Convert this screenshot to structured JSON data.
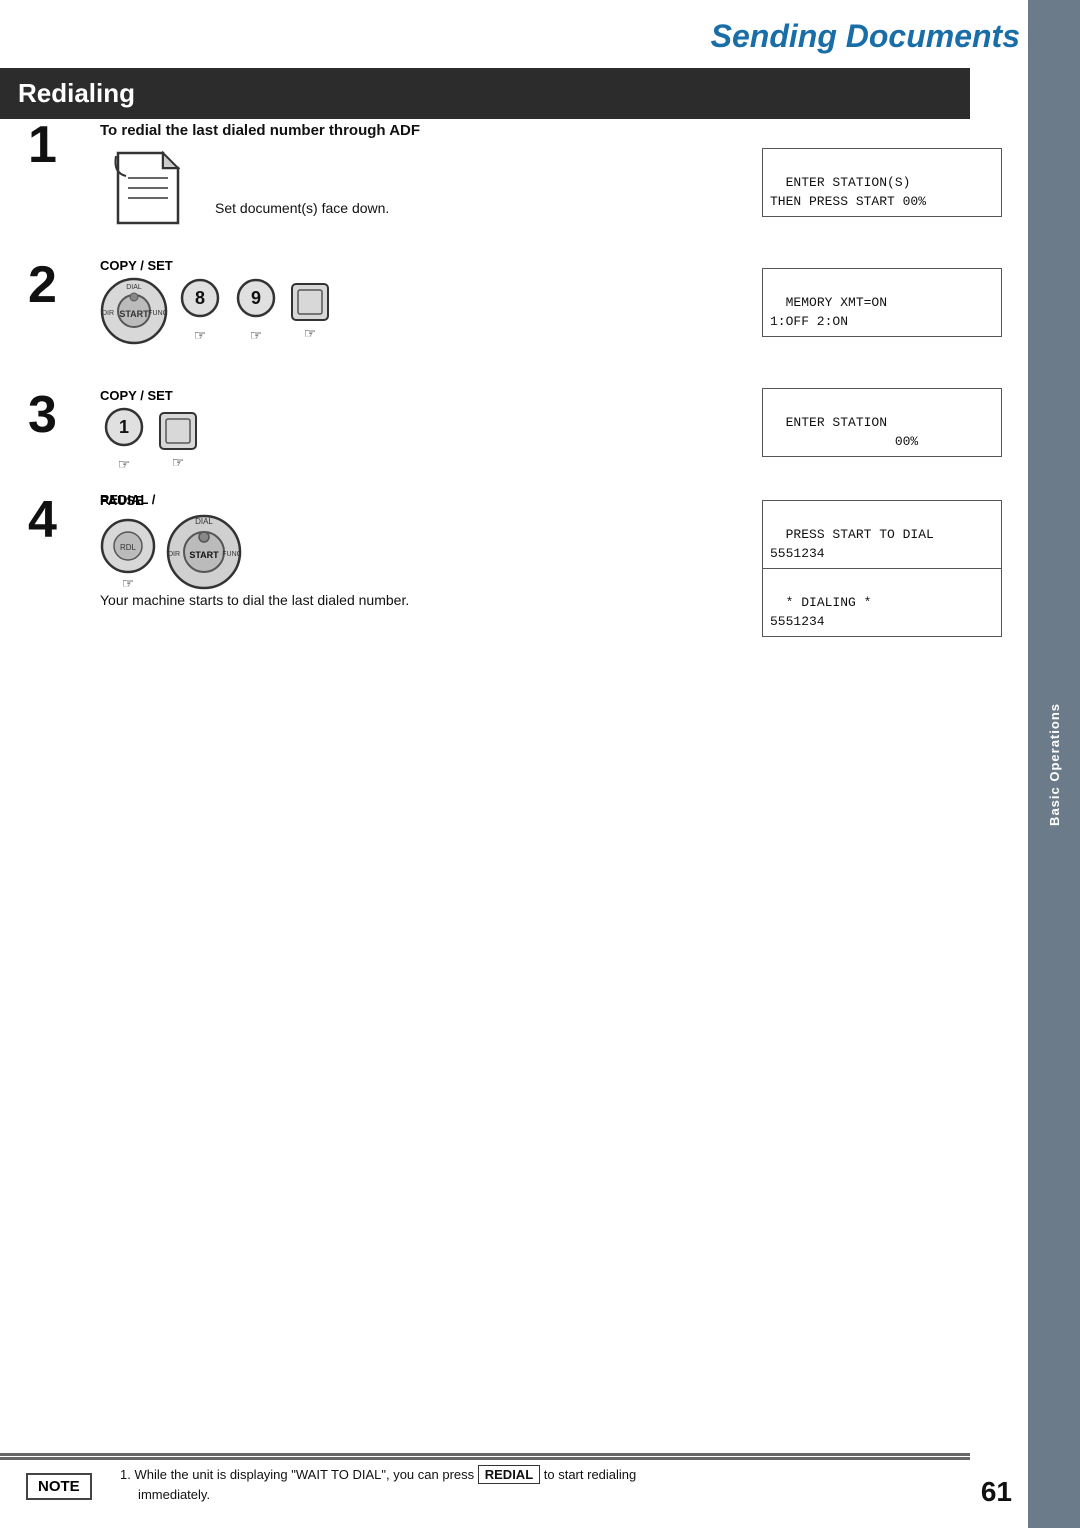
{
  "page": {
    "title": "Sending Documents",
    "section": "Redialing",
    "page_number": "61",
    "sidebar_label": "Basic Operations"
  },
  "steps": {
    "step1": {
      "number": "1",
      "instruction": "To redial the last dialed number through ADF",
      "description": "Set document(s) face down."
    },
    "step2": {
      "number": "2",
      "copy_label": "COPY / SET",
      "buttons": [
        "8",
        "9"
      ]
    },
    "step3": {
      "number": "3",
      "copy_label": "COPY / SET",
      "buttons": [
        "1"
      ]
    },
    "step4": {
      "number": "4",
      "redial_label": "REDIAL /",
      "pause_label": "PAUSE",
      "description": "Your machine starts to dial the last dialed number."
    }
  },
  "lcd_screens": {
    "screen1_line1": "ENTER STATION(S)",
    "screen1_line2": "THEN PRESS START 00%",
    "screen2_line1": "MEMORY XMT=ON",
    "screen2_line2": "1:OFF 2:ON",
    "screen3_line1": "ENTER STATION",
    "screen3_line2": "                00%",
    "screen4_line1": "PRESS START TO DIAL",
    "screen4_line2": "5551234",
    "screen5_line1": "* DIALING *",
    "screen5_line2": "5551234"
  },
  "note": {
    "label": "NOTE",
    "text": "1.  While the unit is displaying \"WAIT TO DIAL\", you can press",
    "redial_key": "REDIAL",
    "text2": "to start redialing immediately."
  }
}
